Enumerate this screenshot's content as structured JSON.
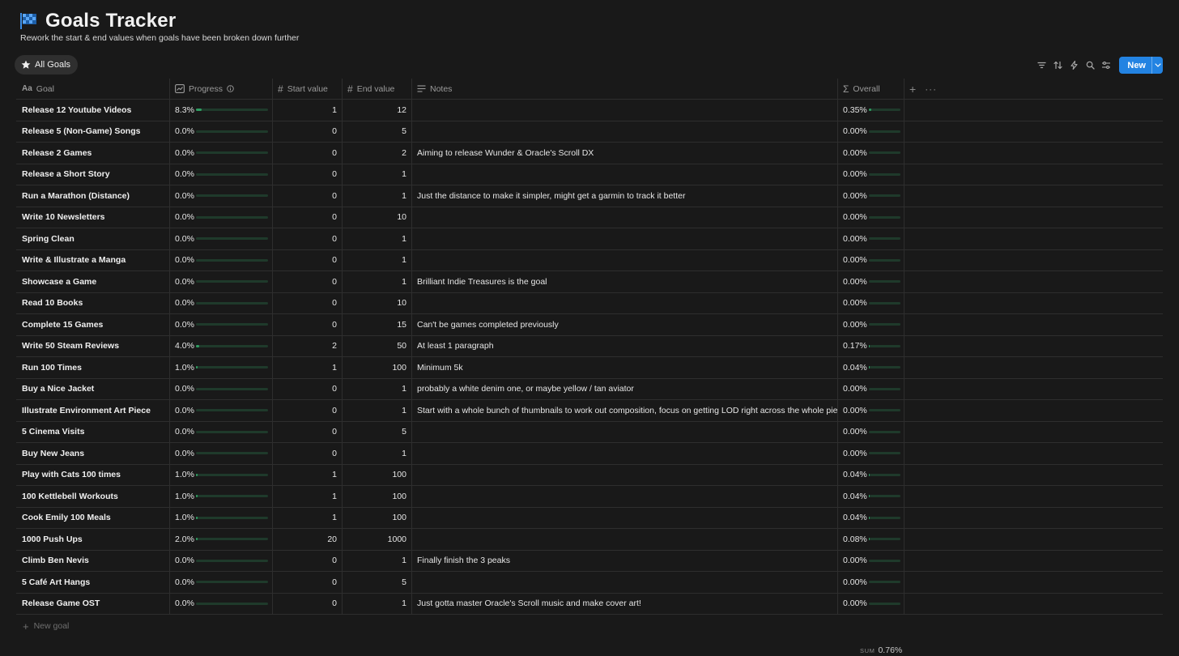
{
  "page": {
    "title": "Goals Tracker",
    "subtitle": "Rework the start & end values when goals have been broken down further",
    "icon": "checkered-flag-icon",
    "colors": {
      "background": "#191919",
      "accent": "#2383e2",
      "progress": "#2f9d62"
    }
  },
  "view": {
    "tab_label": "All Goals",
    "tab_icon": "star-icon"
  },
  "toolbar": {
    "icons": [
      "filter-icon",
      "sort-icon",
      "lightning-icon",
      "search-icon",
      "settings-icon"
    ],
    "new_label": "New"
  },
  "columns": {
    "goal": "Goal",
    "progress": "Progress",
    "start": "Start value",
    "end": "End value",
    "notes": "Notes",
    "overall": "Overall"
  },
  "rows": [
    {
      "goal": "Release 12 Youtube Videos",
      "progress": "8.3%",
      "progress_value": 0.083,
      "start": "1",
      "end": "12",
      "notes": "",
      "overall": "0.35%",
      "overall_value": 0.0035
    },
    {
      "goal": "Release 5 (Non-Game) Songs",
      "progress": "0.0%",
      "progress_value": 0,
      "start": "0",
      "end": "5",
      "notes": "",
      "overall": "0.00%",
      "overall_value": 0
    },
    {
      "goal": "Release 2 Games",
      "progress": "0.0%",
      "progress_value": 0,
      "start": "0",
      "end": "2",
      "notes": "Aiming to release Wunder & Oracle's Scroll DX",
      "overall": "0.00%",
      "overall_value": 0
    },
    {
      "goal": "Release a Short Story",
      "progress": "0.0%",
      "progress_value": 0,
      "start": "0",
      "end": "1",
      "notes": "",
      "overall": "0.00%",
      "overall_value": 0
    },
    {
      "goal": "Run a Marathon (Distance)",
      "progress": "0.0%",
      "progress_value": 0,
      "start": "0",
      "end": "1",
      "notes": "Just the distance to make it simpler, might get a garmin to track it better",
      "overall": "0.00%",
      "overall_value": 0
    },
    {
      "goal": "Write 10 Newsletters",
      "progress": "0.0%",
      "progress_value": 0,
      "start": "0",
      "end": "10",
      "notes": "",
      "overall": "0.00%",
      "overall_value": 0
    },
    {
      "goal": "Spring Clean",
      "progress": "0.0%",
      "progress_value": 0,
      "start": "0",
      "end": "1",
      "notes": "",
      "overall": "0.00%",
      "overall_value": 0
    },
    {
      "goal": "Write & Illustrate a Manga",
      "progress": "0.0%",
      "progress_value": 0,
      "start": "0",
      "end": "1",
      "notes": "",
      "overall": "0.00%",
      "overall_value": 0
    },
    {
      "goal": "Showcase a Game",
      "progress": "0.0%",
      "progress_value": 0,
      "start": "0",
      "end": "1",
      "notes": "Brilliant Indie Treasures is the goal",
      "overall": "0.00%",
      "overall_value": 0
    },
    {
      "goal": "Read 10 Books",
      "progress": "0.0%",
      "progress_value": 0,
      "start": "0",
      "end": "10",
      "notes": "",
      "overall": "0.00%",
      "overall_value": 0
    },
    {
      "goal": "Complete 15 Games",
      "progress": "0.0%",
      "progress_value": 0,
      "start": "0",
      "end": "15",
      "notes": "Can't be games completed previously",
      "overall": "0.00%",
      "overall_value": 0
    },
    {
      "goal": "Write 50 Steam Reviews",
      "progress": "4.0%",
      "progress_value": 0.04,
      "start": "2",
      "end": "50",
      "notes": "At least 1 paragraph",
      "overall": "0.17%",
      "overall_value": 0.0017
    },
    {
      "goal": "Run 100 Times",
      "progress": "1.0%",
      "progress_value": 0.01,
      "start": "1",
      "end": "100",
      "notes": "Minimum 5k",
      "overall": "0.04%",
      "overall_value": 0.0004
    },
    {
      "goal": "Buy a Nice Jacket",
      "progress": "0.0%",
      "progress_value": 0,
      "start": "0",
      "end": "1",
      "notes": "probably a white denim one, or maybe yellow / tan aviator",
      "overall": "0.00%",
      "overall_value": 0
    },
    {
      "goal": "Illustrate Environment Art Piece",
      "progress": "0.0%",
      "progress_value": 0,
      "start": "0",
      "end": "1",
      "notes": "Start with a whole bunch of thumbnails to work out composition, focus on getting LOD right across the whole piece",
      "overall": "0.00%",
      "overall_value": 0
    },
    {
      "goal": "5 Cinema Visits",
      "progress": "0.0%",
      "progress_value": 0,
      "start": "0",
      "end": "5",
      "notes": "",
      "overall": "0.00%",
      "overall_value": 0
    },
    {
      "goal": "Buy New Jeans",
      "progress": "0.0%",
      "progress_value": 0,
      "start": "0",
      "end": "1",
      "notes": "",
      "overall": "0.00%",
      "overall_value": 0
    },
    {
      "goal": "Play with Cats 100 times",
      "progress": "1.0%",
      "progress_value": 0.01,
      "start": "1",
      "end": "100",
      "notes": "",
      "overall": "0.04%",
      "overall_value": 0.0004
    },
    {
      "goal": "100 Kettlebell Workouts",
      "progress": "1.0%",
      "progress_value": 0.01,
      "start": "1",
      "end": "100",
      "notes": "",
      "overall": "0.04%",
      "overall_value": 0.0004
    },
    {
      "goal": "Cook Emily 100 Meals",
      "progress": "1.0%",
      "progress_value": 0.01,
      "start": "1",
      "end": "100",
      "notes": "",
      "overall": "0.04%",
      "overall_value": 0.0004
    },
    {
      "goal": "1000 Push Ups",
      "progress": "2.0%",
      "progress_value": 0.02,
      "start": "20",
      "end": "1000",
      "notes": "",
      "overall": "0.08%",
      "overall_value": 0.0008
    },
    {
      "goal": "Climb Ben Nevis",
      "progress": "0.0%",
      "progress_value": 0,
      "start": "0",
      "end": "1",
      "notes": "Finally finish the 3 peaks",
      "overall": "0.00%",
      "overall_value": 0
    },
    {
      "goal": "5 Café Art Hangs",
      "progress": "0.0%",
      "progress_value": 0,
      "start": "0",
      "end": "5",
      "notes": "",
      "overall": "0.00%",
      "overall_value": 0
    },
    {
      "goal": "Release Game OST",
      "progress": "0.0%",
      "progress_value": 0,
      "start": "0",
      "end": "1",
      "notes": "Just gotta master Oracle's Scroll music and make cover art!",
      "overall": "0.00%",
      "overall_value": 0
    }
  ],
  "new_row_label": "New goal",
  "footer": {
    "sum_label": "SUM",
    "sum_value": "0.76%"
  }
}
